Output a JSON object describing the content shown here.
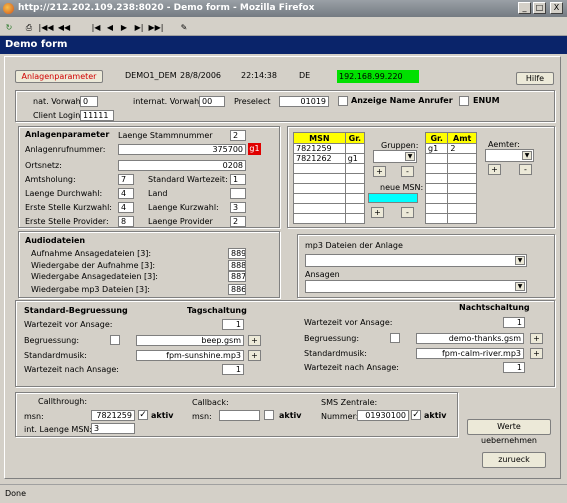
{
  "window": {
    "title": "http://212.202.109.238:8020 - Demo form - Mozilla Firefox",
    "min": "_",
    "max": "□",
    "close": "X"
  },
  "toolbar": {
    "icons": [
      "reload",
      "print",
      "first",
      "prev-block",
      "back-fast",
      "back",
      "forward",
      "forward-fast",
      "last",
      "edit"
    ],
    "glyphs": [
      "↻",
      "⎙",
      "|◀◀",
      "◀◀",
      "|◀",
      "◀",
      "▶",
      "▶|",
      "▶▶|",
      "✎"
    ]
  },
  "app": {
    "title": "Demo form"
  },
  "header": {
    "section_label": "Anlagenparameter",
    "anlage": "DEMO1_DEM",
    "date": "28/8/2006",
    "time": "22:14:38",
    "country": "DE",
    "ip": "192.168.99.220",
    "help": "Hilfe"
  },
  "vorwahl": {
    "nat_label": "nat. Vorwahl:",
    "nat": "0",
    "internat_label": "internat. Vorwahl:",
    "internat": "00",
    "preselect_label": "Preselect",
    "preselect": "01019",
    "anzeige_label": "Anzeige Name Anrufer",
    "enum_label": "ENUM",
    "client_label": "Client Login:",
    "client": "11111"
  },
  "anlage": {
    "heading": "Anlagenparameter",
    "laenge_stamm_label": "Laenge Stammnummer",
    "laenge_stamm": "2",
    "nummer_label": "Anlagenrufnummer:",
    "nummer": "375700",
    "nummer_badge": "g1",
    "ortsnetz_label": "Ortsnetz:",
    "ortsnetz": "0208",
    "amtsholung_label": "Amtsholung:",
    "amtsholung": "7",
    "std_wartezeit_label": "Standard Wartezeit:",
    "std_wartezeit": "1",
    "laenge_durchwahl_label": "Laenge Durchwahl:",
    "laenge_durchwahl": "4",
    "land_label": "Land",
    "land": "",
    "erste_kurzwahl_label": "Erste Stelle Kurzwahl:",
    "erste_kurzwahl": "4",
    "laenge_kurzwahl_label": "Laenge Kurzwahl:",
    "laenge_kurzwahl": "3",
    "erste_provider_label": "Erste Stelle Provider:",
    "erste_provider": "8",
    "laenge_provider_label": "Laenge Provider",
    "laenge_provider": "2"
  },
  "msn": {
    "headers": [
      "MSN",
      "Gr."
    ],
    "rows": [
      [
        "7821259",
        ""
      ],
      [
        "7821262",
        "g1"
      ],
      [
        "",
        ""
      ],
      [
        "",
        ""
      ],
      [
        "",
        ""
      ],
      [
        "",
        ""
      ],
      [
        "",
        ""
      ],
      [
        "",
        ""
      ]
    ],
    "gruppen_label": "Gruppen:",
    "neue_msn_label": "neue MSN:",
    "plus": "+",
    "minus": "-"
  },
  "amt": {
    "headers": [
      "Gr.",
      "Amt"
    ],
    "rows": [
      [
        "g1",
        "2"
      ],
      [
        "",
        ""
      ],
      [
        "",
        ""
      ],
      [
        "",
        ""
      ],
      [
        "",
        ""
      ],
      [
        "",
        ""
      ],
      [
        "",
        ""
      ],
      [
        "",
        ""
      ]
    ],
    "aemter_label": "Aemter:"
  },
  "audio": {
    "heading": "Audiodateien",
    "rows": [
      {
        "label": "Aufnahme Ansagedateien [3]:",
        "value": "889"
      },
      {
        "label": "Wiedergabe der Aufnahme [3]:",
        "value": "888"
      },
      {
        "label": "Wiedergabe Ansagedateien [3]:",
        "value": "887"
      },
      {
        "label": "Wiedergabe mp3 Dateien [3]:",
        "value": "886"
      }
    ],
    "mp3_label": "mp3 Dateien der Anlage",
    "ansagen_label": "Ansagen"
  },
  "begruessung": {
    "heading": "Standard-Begruessung",
    "tag_heading": "Tagschaltung",
    "nacht_heading": "Nachtschaltung",
    "wartezeit_vor_label": "Wartezeit vor Ansage:",
    "begruessung_label": "Begruessung:",
    "standardmusik_label": "Standardmusik:",
    "wartezeit_nach_label": "Wartezeit nach Ansage:",
    "tag": {
      "wartezeit_vor": "1",
      "begruessung": "beep.gsm",
      "musik": "fpm-sunshine.mp3",
      "wartezeit_nach": "1"
    },
    "nacht": {
      "wartezeit_vor": "1",
      "begruessung": "demo-thanks.gsm",
      "musik": "fpm-calm-river.mp3",
      "wartezeit_nach": "1"
    }
  },
  "bottom": {
    "callthrough_label": "Callthrough:",
    "msn_label": "msn:",
    "ct_msn": "7821259",
    "aktiv": "aktiv",
    "int_laenge_label": "int. Laenge MSN:",
    "int_laenge": "3",
    "callback_label": "Callback:",
    "cb_msn": "",
    "sms_label": "SMS Zentrale:",
    "nummer_label": "Nummer:",
    "sms_nummer": "01930100",
    "save": "Werte uebernehmen",
    "back": "zurueck"
  },
  "status": {
    "text": "Done"
  }
}
